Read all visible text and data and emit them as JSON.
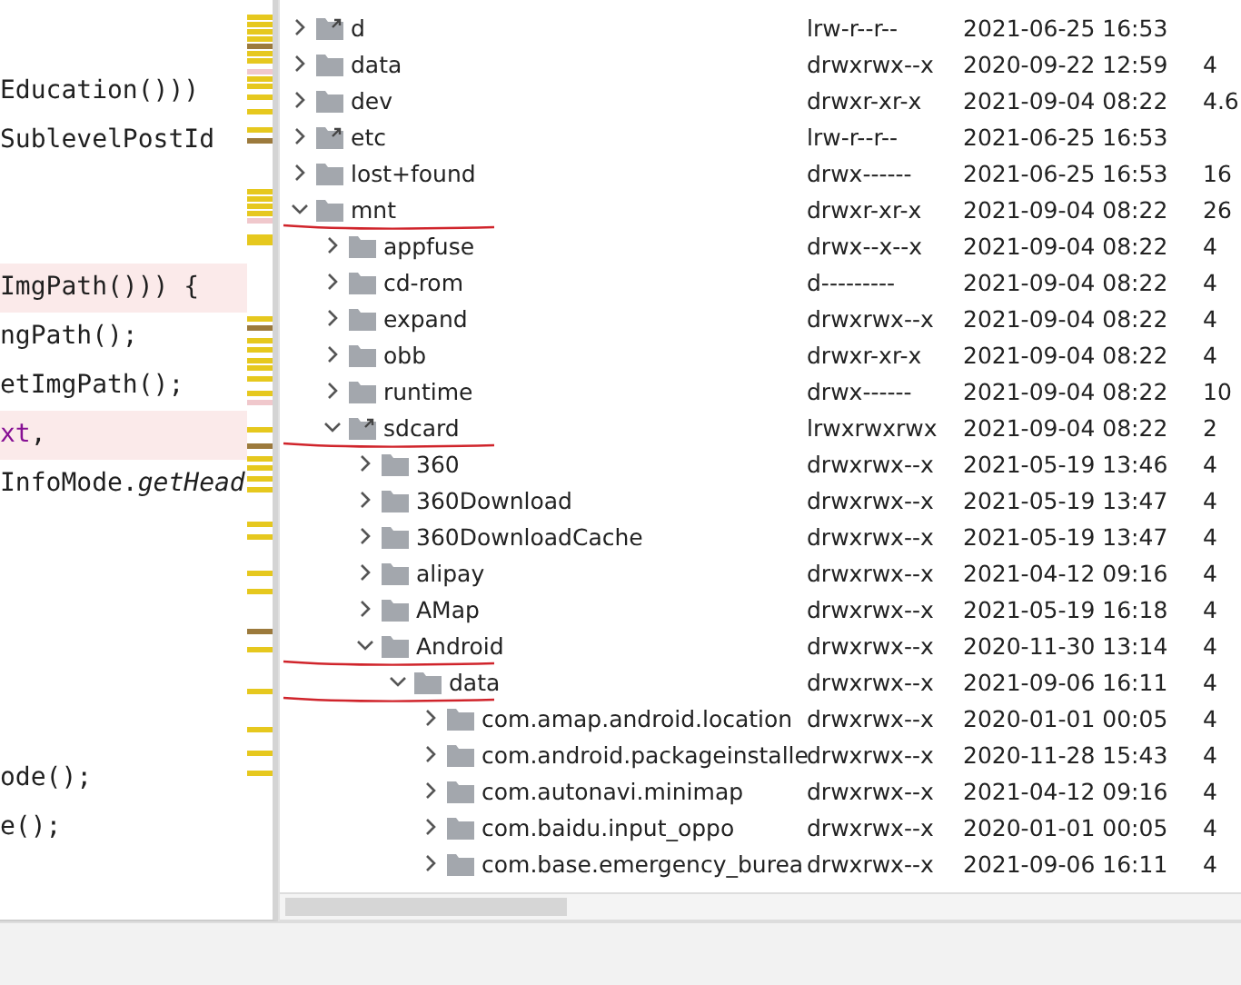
{
  "editor": {
    "lines": [
      {
        "kind": "code",
        "highlighted": false,
        "tokens": [
          {
            "text": "Education()))",
            "kind": "plain"
          }
        ]
      },
      {
        "kind": "code",
        "highlighted": false,
        "tokens": [
          {
            "text": "SublevelPostId",
            "kind": "plain"
          }
        ]
      },
      {
        "kind": "blank"
      },
      {
        "kind": "blank"
      },
      {
        "kind": "code",
        "highlighted": true,
        "tokens": [
          {
            "text": "ImgPath())) {",
            "kind": "plain"
          }
        ]
      },
      {
        "kind": "code",
        "highlighted": false,
        "tokens": [
          {
            "text": "ngPath();",
            "kind": "plain"
          }
        ]
      },
      {
        "kind": "code",
        "highlighted": false,
        "tokens": [
          {
            "text": "etImgPath();",
            "kind": "plain"
          }
        ]
      },
      {
        "kind": "code",
        "highlighted": true,
        "tokens": [
          {
            "text": "xt",
            "kind": "field"
          },
          {
            "text": ",",
            "kind": "plain"
          }
        ]
      },
      {
        "kind": "code",
        "highlighted": false,
        "tokens": [
          {
            "text": "InfoMode.",
            "kind": "plain"
          },
          {
            "text": "getHead",
            "kind": "static"
          }
        ]
      },
      {
        "kind": "blank"
      },
      {
        "kind": "blank"
      },
      {
        "kind": "blank"
      },
      {
        "kind": "blank"
      },
      {
        "kind": "blank"
      },
      {
        "kind": "code",
        "highlighted": false,
        "tokens": [
          {
            "text": "ode();",
            "kind": "plain"
          }
        ]
      },
      {
        "kind": "code",
        "highlighted": false,
        "tokens": [
          {
            "text": "e();",
            "kind": "plain"
          }
        ]
      }
    ]
  },
  "file_tree": [
    {
      "name": "d",
      "symlink": true,
      "expanded": false,
      "marked": false,
      "permissions": "lrw-r--r--",
      "date": "2021-06-25 16:53"
    },
    {
      "name": "data",
      "symlink": false,
      "expanded": false,
      "marked": false,
      "permissions": "drwxrwx--x",
      "date": "2020-09-22 12:59",
      "size": "4"
    },
    {
      "name": "dev",
      "symlink": false,
      "expanded": false,
      "marked": false,
      "permissions": "drwxr-xr-x",
      "date": "2021-09-04 08:22",
      "size": "4.6"
    },
    {
      "name": "etc",
      "symlink": true,
      "expanded": false,
      "marked": false,
      "permissions": "lrw-r--r--",
      "date": "2021-06-25 16:53"
    },
    {
      "name": "lost+found",
      "symlink": false,
      "expanded": false,
      "marked": false,
      "permissions": "drwx------",
      "date": "2021-06-25 16:53",
      "size": "16"
    },
    {
      "name": "mnt",
      "symlink": false,
      "expanded": true,
      "marked": true,
      "permissions": "drwxr-xr-x",
      "date": "2021-09-04 08:22",
      "size": "26",
      "children": [
        {
          "name": "appfuse",
          "symlink": false,
          "expanded": false,
          "marked": false,
          "permissions": "drwx--x--x",
          "date": "2021-09-04 08:22",
          "size": "4"
        },
        {
          "name": "cd-rom",
          "symlink": false,
          "expanded": false,
          "marked": false,
          "permissions": "d---------",
          "date": "2021-09-04 08:22",
          "size": "4"
        },
        {
          "name": "expand",
          "symlink": false,
          "expanded": false,
          "marked": false,
          "permissions": "drwxrwx--x",
          "date": "2021-09-04 08:22",
          "size": "4"
        },
        {
          "name": "obb",
          "symlink": false,
          "expanded": false,
          "marked": false,
          "permissions": "drwxr-xr-x",
          "date": "2021-09-04 08:22",
          "size": "4"
        },
        {
          "name": "runtime",
          "symlink": false,
          "expanded": false,
          "marked": false,
          "permissions": "drwx------",
          "date": "2021-09-04 08:22",
          "size": "10"
        },
        {
          "name": "sdcard",
          "symlink": true,
          "expanded": true,
          "marked": true,
          "permissions": "lrwxrwxrwx",
          "date": "2021-09-04 08:22",
          "size": "2",
          "children": [
            {
              "name": "360",
              "symlink": false,
              "expanded": false,
              "marked": false,
              "permissions": "drwxrwx--x",
              "date": "2021-05-19 13:46",
              "size": "4"
            },
            {
              "name": "360Download",
              "symlink": false,
              "expanded": false,
              "marked": false,
              "permissions": "drwxrwx--x",
              "date": "2021-05-19 13:47",
              "size": "4"
            },
            {
              "name": "360DownloadCache",
              "symlink": false,
              "expanded": false,
              "marked": false,
              "permissions": "drwxrwx--x",
              "date": "2021-05-19 13:47",
              "size": "4"
            },
            {
              "name": "alipay",
              "symlink": false,
              "expanded": false,
              "marked": false,
              "permissions": "drwxrwx--x",
              "date": "2021-04-12 09:16",
              "size": "4"
            },
            {
              "name": "AMap",
              "symlink": false,
              "expanded": false,
              "marked": false,
              "permissions": "drwxrwx--x",
              "date": "2021-05-19 16:18",
              "size": "4"
            },
            {
              "name": "Android",
              "symlink": false,
              "expanded": true,
              "marked": true,
              "permissions": "drwxrwx--x",
              "date": "2020-11-30 13:14",
              "size": "4",
              "children": [
                {
                  "name": "data",
                  "symlink": false,
                  "expanded": true,
                  "marked": true,
                  "permissions": "drwxrwx--x",
                  "date": "2021-09-06 16:11",
                  "size": "4",
                  "children": [
                    {
                      "name": "com.amap.android.location",
                      "symlink": false,
                      "expanded": false,
                      "marked": false,
                      "permissions": "drwxrwx--x",
                      "date": "2020-01-01 00:05",
                      "size": "4"
                    },
                    {
                      "name": "com.android.packageinstalle",
                      "symlink": false,
                      "expanded": false,
                      "marked": false,
                      "permissions": "drwxrwx--x",
                      "date": "2020-11-28 15:43",
                      "size": "4"
                    },
                    {
                      "name": "com.autonavi.minimap",
                      "symlink": false,
                      "expanded": false,
                      "marked": false,
                      "permissions": "drwxrwx--x",
                      "date": "2021-04-12 09:16",
                      "size": "4"
                    },
                    {
                      "name": "com.baidu.input_oppo",
                      "symlink": false,
                      "expanded": false,
                      "marked": false,
                      "permissions": "drwxrwx--x",
                      "date": "2020-01-01 00:05",
                      "size": "4"
                    },
                    {
                      "name": "com.base.emergency_burea",
                      "symlink": false,
                      "expanded": false,
                      "marked": false,
                      "permissions": "drwxrwx--x",
                      "date": "2021-09-06 16:11",
                      "size": "4"
                    }
                  ]
                }
              ]
            }
          ]
        }
      ]
    }
  ]
}
